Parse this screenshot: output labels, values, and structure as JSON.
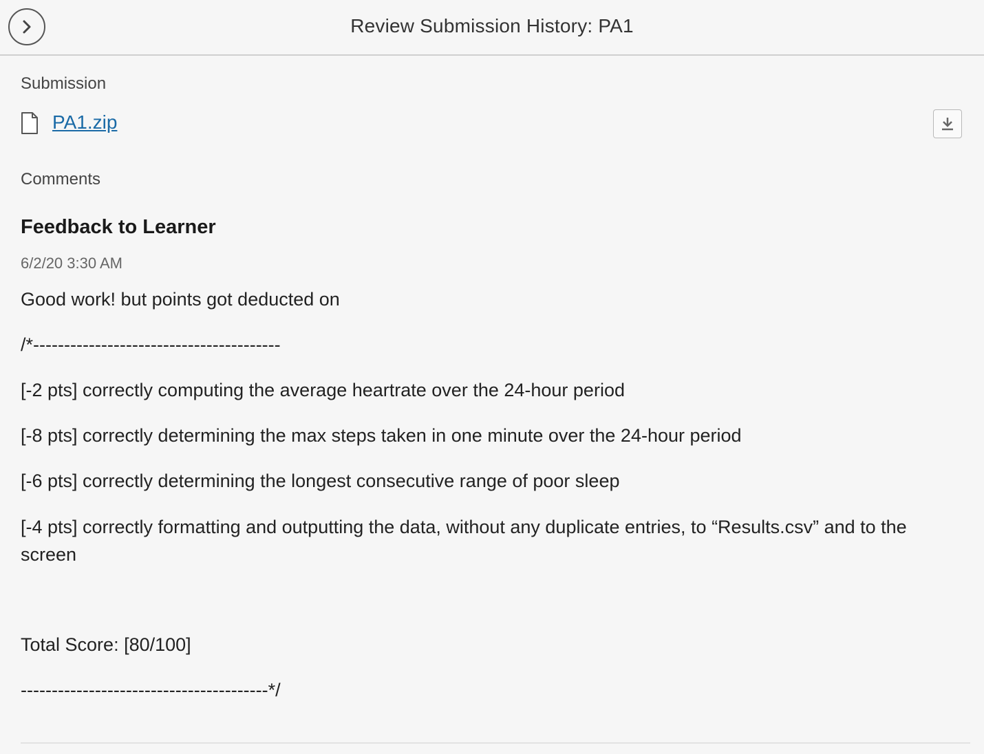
{
  "header": {
    "title": "Review Submission History: PA1",
    "back_icon": "chevron-right-icon"
  },
  "submission": {
    "label": "Submission",
    "file_name": "PA1.zip",
    "file_icon": "document-icon",
    "download_icon": "download-icon"
  },
  "comments": {
    "label": "Comments",
    "feedback_title": "Feedback to Learner",
    "timestamp": "6/2/20 3:30 AM",
    "lines": [
      "Good work! but points got deducted on",
      "/*----------------------------------------",
      "[-2 pts] correctly computing the average heartrate over the 24-hour period",
      "[-8 pts] correctly determining the max steps taken in one minute over the 24-hour period",
      "[-6 pts] correctly determining the longest consecutive range of poor sleep",
      "[-4 pts] correctly formatting and outputting the data, without any duplicate entries, to “Results.csv” and to the screen",
      "Total Score: [80/100]",
      "----------------------------------------*/"
    ]
  },
  "colors": {
    "background": "#f6f6f6",
    "link": "#1a6aa6",
    "border": "#cfcfcf"
  }
}
